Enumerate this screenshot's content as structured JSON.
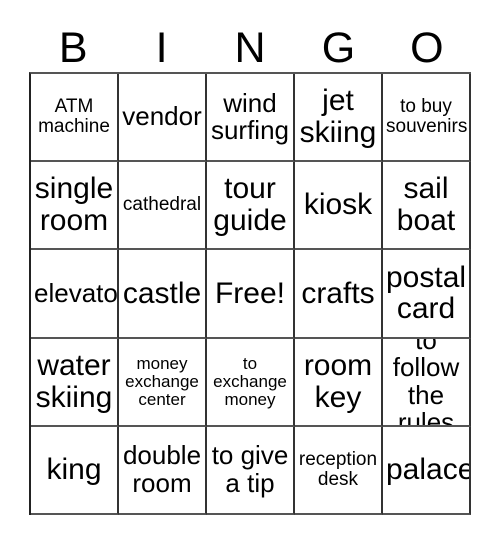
{
  "card": {
    "title": "BINGO",
    "background_color": "#ffffff",
    "text_color": "#000000",
    "border_color": "#333333"
  },
  "header": {
    "letters": [
      "B",
      "I",
      "N",
      "G",
      "O"
    ]
  },
  "grid": {
    "columns": 5,
    "rows": 5,
    "free_space_label": "Free!",
    "cells": [
      {
        "text": "ATM\nmachine",
        "size": "fs-md",
        "column": "B",
        "row": 1,
        "free": false
      },
      {
        "text": "vendor",
        "size": "fs-lg",
        "column": "I",
        "row": 1,
        "free": false
      },
      {
        "text": "wind\nsurfing",
        "size": "fs-lg",
        "column": "N",
        "row": 1,
        "free": false
      },
      {
        "text": "jet\nskiing",
        "size": "fs-xl",
        "column": "G",
        "row": 1,
        "free": false
      },
      {
        "text": "to buy\nsouvenirs",
        "size": "fs-md",
        "column": "O",
        "row": 1,
        "free": false
      },
      {
        "text": "single\nroom",
        "size": "fs-xl",
        "column": "B",
        "row": 2,
        "free": false
      },
      {
        "text": "cathedral",
        "size": "fs-md",
        "column": "I",
        "row": 2,
        "free": false
      },
      {
        "text": "tour\nguide",
        "size": "fs-xl",
        "column": "N",
        "row": 2,
        "free": false
      },
      {
        "text": "kiosk",
        "size": "fs-xl",
        "column": "G",
        "row": 2,
        "free": false
      },
      {
        "text": "sail\nboat",
        "size": "fs-xl",
        "column": "O",
        "row": 2,
        "free": false
      },
      {
        "text": "elevator",
        "size": "fs-lg",
        "column": "B",
        "row": 3,
        "free": false
      },
      {
        "text": "castle",
        "size": "fs-xl",
        "column": "I",
        "row": 3,
        "free": false
      },
      {
        "text": "Free!",
        "size": "fs-xl",
        "column": "N",
        "row": 3,
        "free": true
      },
      {
        "text": "crafts",
        "size": "fs-xl",
        "column": "G",
        "row": 3,
        "free": false
      },
      {
        "text": "postal\ncard",
        "size": "fs-xl",
        "column": "O",
        "row": 3,
        "free": false
      },
      {
        "text": "water\nskiing",
        "size": "fs-xl",
        "column": "B",
        "row": 4,
        "free": false
      },
      {
        "text": "money\nexchange\ncenter",
        "size": "fs-sm",
        "column": "I",
        "row": 4,
        "free": false
      },
      {
        "text": "to\nexchange\nmoney",
        "size": "fs-sm",
        "column": "N",
        "row": 4,
        "free": false
      },
      {
        "text": "room\nkey",
        "size": "fs-xl",
        "column": "G",
        "row": 4,
        "free": false
      },
      {
        "text": "to follow\nthe rules",
        "size": "fs-lg",
        "column": "O",
        "row": 4,
        "free": false
      },
      {
        "text": "king",
        "size": "fs-xl",
        "column": "B",
        "row": 5,
        "free": false
      },
      {
        "text": "double\nroom",
        "size": "fs-lg",
        "column": "I",
        "row": 5,
        "free": false
      },
      {
        "text": "to give\na tip",
        "size": "fs-lg",
        "column": "N",
        "row": 5,
        "free": false
      },
      {
        "text": "reception\ndesk",
        "size": "fs-md",
        "column": "G",
        "row": 5,
        "free": false
      },
      {
        "text": "palace",
        "size": "fs-xl",
        "column": "O",
        "row": 5,
        "free": false
      }
    ]
  }
}
